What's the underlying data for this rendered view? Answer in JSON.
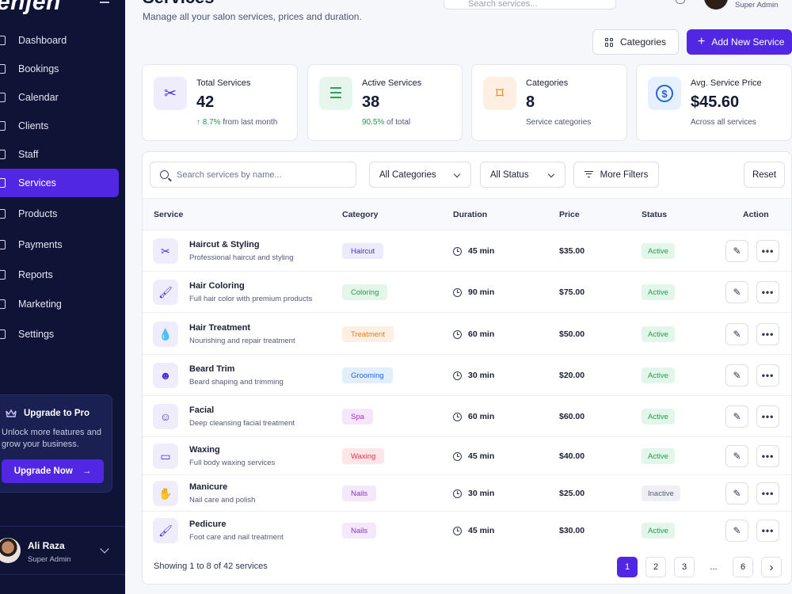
{
  "sidebar": {
    "logo": "enjen",
    "nav": [
      {
        "label": "Dashboard",
        "name": "dashboard"
      },
      {
        "label": "Bookings",
        "name": "bookings"
      },
      {
        "label": "Calendar",
        "name": "calendar"
      },
      {
        "label": "Clients",
        "name": "clients"
      },
      {
        "label": "Staff",
        "name": "staff"
      },
      {
        "label": "Services",
        "name": "services",
        "active": true
      },
      {
        "label": "Products",
        "name": "products"
      },
      {
        "label": "Payments",
        "name": "payments"
      },
      {
        "label": "Reports",
        "name": "reports"
      },
      {
        "label": "Marketing",
        "name": "marketing"
      },
      {
        "label": "Settings",
        "name": "settings"
      }
    ],
    "upgrade": {
      "title": "Upgrade to Pro",
      "text": "Unlock more features and grow your business.",
      "button": "Upgrade Now"
    },
    "user": {
      "name": "Ali Raza",
      "role": "Super Admin"
    }
  },
  "header": {
    "title": "Services",
    "subtitle": "Manage all your salon services, prices and duration.",
    "search_placeholder": "Search services...",
    "user_role": "Super Admin",
    "categories_button": "Categories",
    "add_button": "Add New Service"
  },
  "stats": [
    {
      "label": "Total Services",
      "value": "42",
      "foot_highlight": "↑ 8.7%",
      "foot_rest": " from last month",
      "icon": "scissors-icon",
      "bg": "#efedfc",
      "fg": "#4b2bd9"
    },
    {
      "label": "Active Services",
      "value": "38",
      "foot_highlight": "90.5%",
      "foot_rest": " of total",
      "icon": "list-icon",
      "bg": "#e6f6ec",
      "fg": "#1f9d4d"
    },
    {
      "label": "Categories",
      "value": "8",
      "foot_highlight": "",
      "foot_rest": "Service categories",
      "icon": "tag-icon",
      "bg": "#fdf0e3",
      "fg": "#e07b20"
    },
    {
      "label": "Avg. Service Price",
      "value": "$45.60",
      "foot_highlight": "",
      "foot_rest": "Across all services",
      "icon": "dollar-icon",
      "bg": "#e7f0fe",
      "fg": "#2463d8"
    }
  ],
  "filters": {
    "search_placeholder": "Search services by name...",
    "category": "All Categories",
    "status": "All Status",
    "more": "More Filters",
    "reset": "Reset"
  },
  "table": {
    "columns": [
      "Service",
      "Category",
      "Duration",
      "Price",
      "Status",
      "Action"
    ],
    "rows": [
      {
        "name": "Haircut & Styling",
        "desc": "Professional haircut and styling",
        "category": "Haircut",
        "cat_bg": "#ecebfb",
        "cat_fg": "#4b2bd9",
        "duration": "45 min",
        "price": "$35.00",
        "status": "Active",
        "icon": "scissors-icon",
        "glyph": "✂"
      },
      {
        "name": "Hair Coloring",
        "desc": "Full hair color with premium products",
        "category": "Coloring",
        "cat_bg": "#e4f6ea",
        "cat_fg": "#1f9d4d",
        "duration": "90 min",
        "price": "$75.00",
        "status": "Active",
        "icon": "brush-icon",
        "glyph": "🖌"
      },
      {
        "name": "Hair Treatment",
        "desc": "Nourishing and repair treatment",
        "category": "Treatment",
        "cat_bg": "#fdf0e2",
        "cat_fg": "#e07b20",
        "duration": "60 min",
        "price": "$50.00",
        "status": "Active",
        "icon": "droplet-icon",
        "glyph": "💧"
      },
      {
        "name": "Beard Trim",
        "desc": "Beard shaping and trimming",
        "category": "Grooming",
        "cat_bg": "#e3eefd",
        "cat_fg": "#2463d8",
        "duration": "30 min",
        "price": "$20.00",
        "status": "Active",
        "icon": "beard-icon",
        "glyph": "☻"
      },
      {
        "name": "Facial",
        "desc": "Deep cleansing facial treatment",
        "category": "Spa",
        "cat_bg": "#f6e6fb",
        "cat_fg": "#a22fc9",
        "duration": "60 min",
        "price": "$60.00",
        "status": "Active",
        "icon": "face-icon",
        "glyph": "☺"
      },
      {
        "name": "Waxing",
        "desc": "Full body waxing services",
        "category": "Waxing",
        "cat_bg": "#fde6e8",
        "cat_fg": "#e0334a",
        "duration": "45 min",
        "price": "$40.00",
        "status": "Active",
        "icon": "wax-strip-icon",
        "glyph": "▭"
      },
      {
        "name": "Manicure",
        "desc": "Nail care and polish",
        "category": "Nails",
        "cat_bg": "#f3e8fc",
        "cat_fg": "#8a35c9",
        "duration": "30 min",
        "price": "$25.00",
        "status": "Inactive",
        "icon": "hand-icon",
        "glyph": "✋"
      },
      {
        "name": "Pedicure",
        "desc": "Foot care and nail treatment",
        "category": "Nails",
        "cat_bg": "#f3e8fc",
        "cat_fg": "#8a35c9",
        "duration": "45 min",
        "price": "$30.00",
        "status": "Active",
        "icon": "foot-brush-icon",
        "glyph": "🖌"
      }
    ]
  },
  "pagination": {
    "summary": "Showing 1 to 8 of 42 services",
    "pages": [
      "1",
      "2",
      "3",
      "...",
      "6"
    ],
    "current": "1",
    "next": "›"
  },
  "colors": {
    "accent": "#5227e3",
    "sidebar": "#0f1437",
    "active_green": "#1f9d4d"
  }
}
